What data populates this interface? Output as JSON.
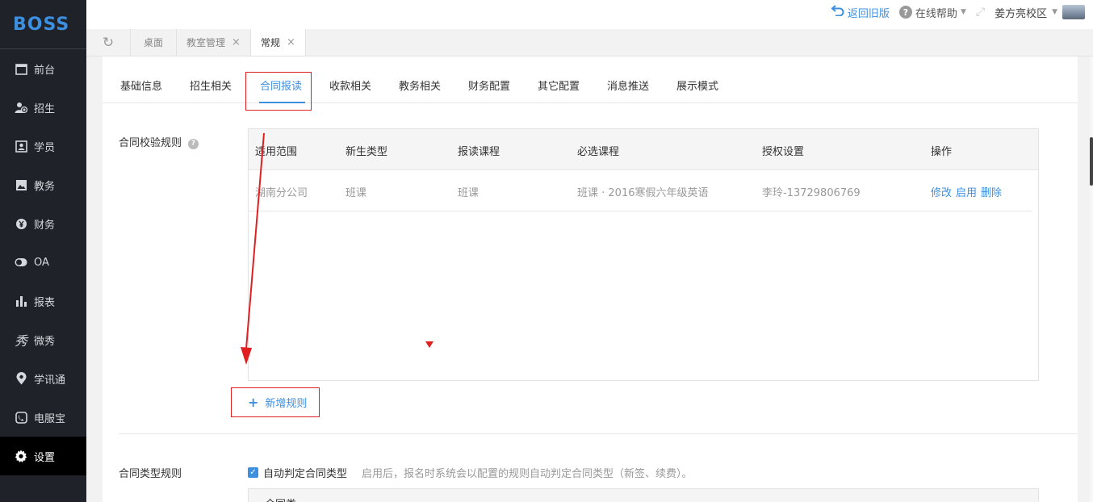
{
  "app": {
    "logo": "BOSS"
  },
  "sidebar": {
    "items": [
      {
        "label": "前台",
        "icon": "calendar-icon"
      },
      {
        "label": "招生",
        "icon": "add-user-icon"
      },
      {
        "label": "学员",
        "icon": "id-card-icon"
      },
      {
        "label": "教务",
        "icon": "picture-icon"
      },
      {
        "label": "财务",
        "icon": "yen-icon"
      },
      {
        "label": "OA",
        "icon": "toggle-icon"
      },
      {
        "label": "报表",
        "icon": "bar-chart-icon"
      },
      {
        "label": "微秀",
        "icon": "xiu-icon"
      },
      {
        "label": "学讯通",
        "icon": "location-pin-icon"
      },
      {
        "label": "电服宝",
        "icon": "phone-icon"
      },
      {
        "label": "设置",
        "icon": "gear-icon",
        "active": true
      }
    ]
  },
  "topbar": {
    "back_label": "返回旧版",
    "help_label": "在线帮助",
    "campus_label": "姜方亮校区"
  },
  "page_tabs": [
    {
      "label": "桌面",
      "closable": false
    },
    {
      "label": "教室管理",
      "closable": true
    },
    {
      "label": "常规",
      "closable": true,
      "active": true
    }
  ],
  "subtabs": [
    {
      "label": "基础信息"
    },
    {
      "label": "招生相关"
    },
    {
      "label": "合同报读",
      "active": true
    },
    {
      "label": "收款相关"
    },
    {
      "label": "教务相关"
    },
    {
      "label": "财务配置"
    },
    {
      "label": "其它配置"
    },
    {
      "label": "消息推送"
    },
    {
      "label": "展示模式"
    }
  ],
  "contract_rules": {
    "section_label": "合同校验规则",
    "headers": [
      "适用范围",
      "新生类型",
      "报读课程",
      "必选课程",
      "授权设置",
      "操作"
    ],
    "rows": [
      {
        "scope": "湖南分公司",
        "new_type": "班课",
        "course": "班课",
        "required": "班课 · 2016寒假六年级英语",
        "auth": "李玲-13729806769",
        "actions": [
          "修改",
          "启用",
          "删除"
        ]
      }
    ],
    "add_label": "新增规则"
  },
  "contract_type": {
    "section_label": "合同类型规则",
    "checkbox_label": "自动判定合同类型",
    "checked": true,
    "hint": "启用后，报名时系统会以配置的规则自动判定合同类型（新签、续费）。",
    "table_header": "合同类"
  },
  "colors": {
    "accent": "#3d8fe0",
    "annotation": "#e02020",
    "sidebar_bg": "#1f2329"
  }
}
